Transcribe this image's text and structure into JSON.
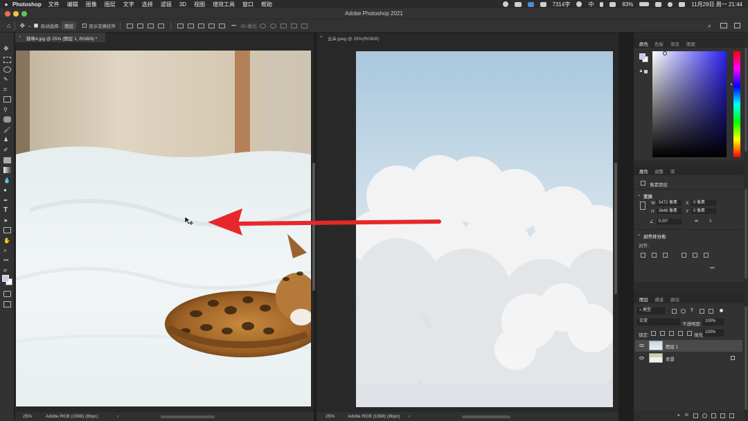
{
  "menubar": {
    "app_name": "Photoshop",
    "items": [
      "文件",
      "编辑",
      "图像",
      "图层",
      "文字",
      "选择",
      "滤镜",
      "3D",
      "视图",
      "增效工具",
      "窗口",
      "帮助"
    ],
    "word_count": "7314字",
    "ime": "中",
    "battery": "83%",
    "clock": "11月29日 周一  21:44"
  },
  "window": {
    "title": "Adobe Photoshop 2021"
  },
  "options_bar": {
    "auto_select_label": "自动选择:",
    "auto_select_value": "图层",
    "show_transform_label": "显示变换控件",
    "mode_3d_label": "3D 模式:"
  },
  "doc_left": {
    "tab_close": "×",
    "tab_title": "猫咪4.jpg @ 25% (图层 1, RGB/8) *",
    "zoom": "25%",
    "profile": "Adobe RGB (1998) (8bpc)",
    "more": "›"
  },
  "doc_right": {
    "tab_close": "×",
    "tab_title": "云朵.jpeg @ 25%(RGB/8)",
    "zoom": "25%",
    "profile": "Adobe RGB (1998) (8bpc)",
    "more": "›"
  },
  "color_panel": {
    "tabs": [
      "颜色",
      "色板",
      "渐变",
      "图案"
    ],
    "foreground": "#c9c9ea",
    "hue": "#2a20f0"
  },
  "properties_panel": {
    "tabs": [
      "属性",
      "调整",
      "库"
    ],
    "layer_type": "像素图层",
    "transform_title": "变换",
    "w_label": "W",
    "w_value": "5472 像素",
    "x_label": "X",
    "x_value": "0 像素",
    "h_label": "H",
    "h_value": "3648 像素",
    "y_label": "Y",
    "y_value": "0 像素",
    "angle_value": "0.00°",
    "align_title": "对齐并分布",
    "align_label": "对齐:",
    "more_dots": "•••"
  },
  "layers_panel": {
    "tabs": [
      "图层",
      "通道",
      "路径"
    ],
    "filter_label": "类型",
    "blend_mode": "正常",
    "opacity_label": "不透明度:",
    "opacity_value": "100%",
    "lock_label": "锁定:",
    "fill_label": "填充:",
    "fill_value": "100%",
    "layers": [
      {
        "name": "图层 1",
        "selected": true,
        "locked": false
      },
      {
        "name": "背景",
        "selected": false,
        "locked": true
      }
    ],
    "fx_label": "fx"
  }
}
